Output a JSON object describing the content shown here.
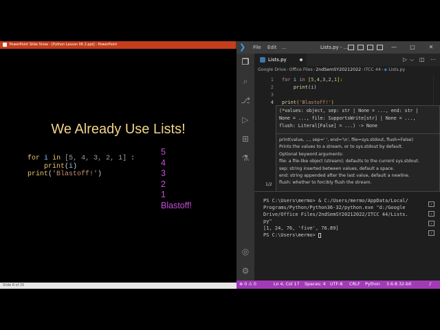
{
  "ppt": {
    "window_title": "PowerPoint Slide Show - [Python Lesson 06 2.ppt] - PowerPoint",
    "slide_title": "We Already Use Lists!",
    "code": {
      "line1": {
        "kw": "for",
        "var": "i",
        "in": "in",
        "list": "[5, 4, 3, 2, 1]",
        "colon": " :"
      },
      "line2": {
        "fn": "print",
        "arg": "i"
      },
      "line3": {
        "fn": "print",
        "str": "'Blastoff!'"
      }
    },
    "output": [
      "5",
      "4",
      "3",
      "2",
      "1",
      "Blastoff!"
    ],
    "status": "Slide 8 of 25"
  },
  "vscode": {
    "menu": [
      "File",
      "Edit",
      "..."
    ],
    "window_title": "Lists.py - ...",
    "tab": {
      "label": "Lists.py"
    },
    "breadcrumb": [
      "Google Drive",
      "Office Files",
      "2ndSemSY20212022",
      "ITCC 44",
      "Lists.py"
    ],
    "editor": {
      "lines": [
        {
          "num": "1",
          "kw": "for",
          "var": "i",
          "in": "in",
          "list_open": "[",
          "list_vals": "5,4,3,2,1",
          "list_close": "]",
          "tail": ":"
        },
        {
          "num": "2",
          "fn": "print",
          "arg": "i"
        },
        {
          "num": "3"
        },
        {
          "num": "4",
          "fn": "print",
          "str": "'Blastoff!'"
        }
      ]
    },
    "hover": {
      "sig1": "(*values: object, sep: str | None = ..., end: str |",
      "sig2": "None = ..., file: SupportsWrite[str] | None = ...,",
      "sig3": "flush: Literal[False] = ...) -> None",
      "count": "1/2",
      "doc": [
        "print(value, ..., sep=' ', end='\\n', file=sys.stdout, flush=False)",
        "Prints the values to a stream, or to sys.stdout by default.",
        "Optional keyword arguments:",
        "file: a file-like object (stream); defaults to the current sys.stdout.",
        "sep: string inserted between values, default a space.",
        "end: string appended after the last value, default a newline.",
        "flush: whether to forcibly flush the stream."
      ]
    },
    "terminal": [
      "PS C:\\Users\\mermo> & C:/Users/mermo/AppData/Local/",
      "Programs/Python/Python36-32/python.exe \"d:/Google",
      "Drive/Office Files/2ndSemSY20212022/ITCC 44/Lists.",
      "py\"",
      "[1, 24, 76, 'five', 76.89]",
      "PS C:\\Users\\mermo> "
    ],
    "status": {
      "errors": "⊗ 0 ⚠ 0",
      "position": "Ln 4, Col 17",
      "spaces": "Spaces: 4",
      "encoding": "UTF-8",
      "eol": "CRLF",
      "language": "Python",
      "interpreter": "3.6.8 32-bit"
    }
  }
}
